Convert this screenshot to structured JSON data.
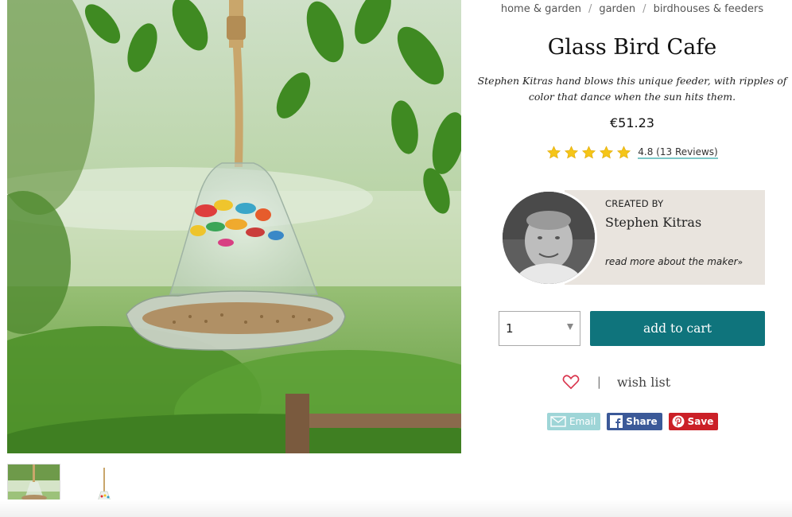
{
  "breadcrumb": {
    "items": [
      "home & garden",
      "garden",
      "birdhouses & feeders"
    ],
    "separator": "/"
  },
  "product": {
    "title": "Glass Bird Cafe",
    "description": "Stephen Kitras hand blows this unique feeder, with ripples of color that dance when the sun hits them.",
    "price": "€51.23",
    "rating": 4.8,
    "rating_text": "4.8 (13 Reviews)",
    "stars": 5
  },
  "maker": {
    "created_by_label": "CREATED BY",
    "name": "Stephen Kitras",
    "link_label": "read more about the maker",
    "link_suffix": "»"
  },
  "purchase": {
    "quantity": "1",
    "add_to_cart_label": "add to cart"
  },
  "wishlist": {
    "separator": "|",
    "label": "wish list"
  },
  "share": {
    "email_label": "Email",
    "facebook_label": "Share",
    "pinterest_label": "Save"
  },
  "icons": {
    "star": "star-icon",
    "heart": "heart-icon",
    "dropdown": "chevron-down-icon",
    "email": "envelope-icon",
    "facebook": "facebook-icon",
    "pinterest": "pinterest-icon"
  },
  "colors": {
    "accent_teal": "#0f747c",
    "star_gold": "#f5c518",
    "heart_red": "#d9334c",
    "email_bg": "#9ed5d7",
    "facebook_bg": "#3b5998",
    "pinterest_bg": "#cb2027",
    "maker_card_bg": "#e9e4de"
  }
}
